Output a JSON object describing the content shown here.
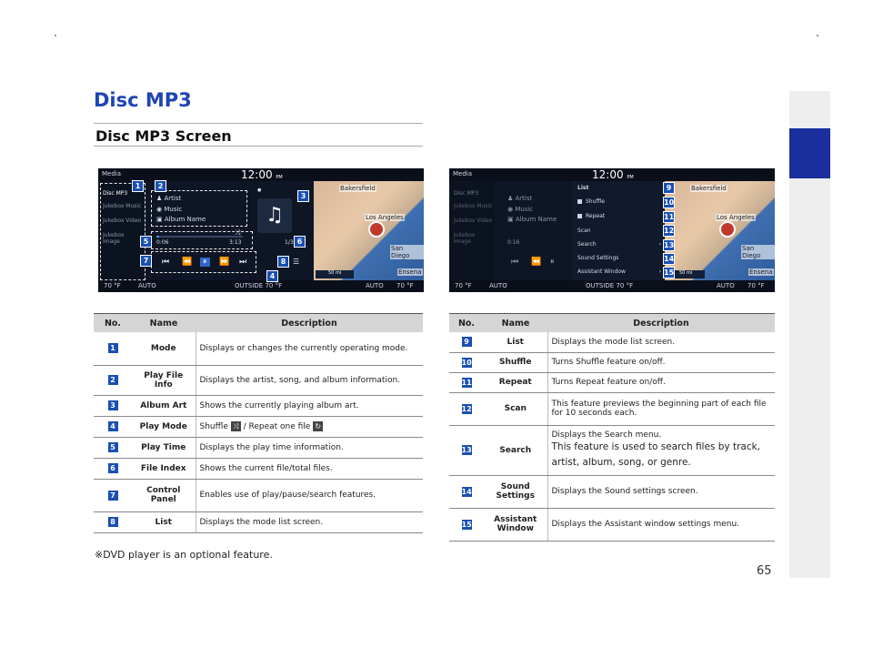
{
  "section_title": "Disc MP3",
  "subsection_title": "Disc MP3 Screen",
  "screen_left": {
    "header": "Media",
    "clock": "12:00",
    "clock_ampm": "PM",
    "modes": [
      "Disc MP3",
      "Jukebox Music",
      "Jukebox Video",
      "Jukebox Image"
    ],
    "artist": "Artist",
    "music": "Music",
    "album": "Album Name",
    "time_elapsed": "0:06",
    "time_total": "3:13",
    "file_index": "1/3",
    "progress_fraction": 0.03,
    "map_cities": [
      "Bakersfield",
      "Los Angeles",
      "San Diego",
      "Ensena"
    ],
    "map_scale": "50 mi",
    "bottom_left_temp": "70 °F",
    "bottom_left_mode": "AUTO",
    "outside": "OUTSIDE  70 °F",
    "bottom_right_mode": "AUTO",
    "bottom_right_temp": "70 °F",
    "badges": [
      "1",
      "2",
      "3",
      "4",
      "5",
      "6",
      "7",
      "8"
    ]
  },
  "screen_right": {
    "header": "Media",
    "clock": "12:00",
    "clock_ampm": "PM",
    "modes": [
      "Disc MP3",
      "Jukebox Music",
      "Jukebox Video",
      "Jukebox Image"
    ],
    "artist": "Artist",
    "music": "Music",
    "album": "Album Name",
    "time_elapsed": "0:16",
    "list_title": "List",
    "list_items": [
      "Shuffle",
      "Repeat",
      "Scan",
      "Search",
      "Sound Settings",
      "Assistant Window"
    ],
    "map_cities": [
      "Bakersfield",
      "Los Angeles",
      "San Diego",
      "Ensena"
    ],
    "map_scale": "50 mi",
    "bottom_left_temp": "70 °F",
    "bottom_left_mode": "AUTO",
    "outside": "OUTSIDE  70 °F",
    "bottom_right_mode": "AUTO",
    "bottom_right_temp": "70 °F",
    "badges": [
      "9",
      "10",
      "11",
      "12",
      "13",
      "14",
      "15"
    ]
  },
  "table_headers": {
    "no": "No.",
    "name": "Name",
    "description": "Description"
  },
  "table_left": [
    {
      "no": "1",
      "name": "Mode",
      "desc": "Displays or changes the currently operating mode."
    },
    {
      "no": "2",
      "name": "Play File Info",
      "desc": "Displays the artist, song, and album information."
    },
    {
      "no": "3",
      "name": "Album Art",
      "desc": "Shows the currently playing album art."
    },
    {
      "no": "4",
      "name": "Play Mode",
      "desc_a": "Shuffle",
      "desc_b": " / Repeat one file "
    },
    {
      "no": "5",
      "name": "Play Time",
      "desc": "Displays the play time information."
    },
    {
      "no": "6",
      "name": "File Index",
      "desc": "Shows the current file/total files."
    },
    {
      "no": "7",
      "name": "Control Panel",
      "desc": "Enables use of play/pause/search features."
    },
    {
      "no": "8",
      "name": "List",
      "desc": "Displays the mode list screen."
    }
  ],
  "table_right": [
    {
      "no": "9",
      "name": "List",
      "desc": "Displays the mode list screen."
    },
    {
      "no": "10",
      "name": "Shuffle",
      "desc": "Turns Shuffle feature on/off."
    },
    {
      "no": "11",
      "name": "Repeat",
      "desc": "Turns Repeat feature on/off."
    },
    {
      "no": "12",
      "name": "Scan",
      "desc": "This feature previews the beginning part of each file for 10 seconds each."
    },
    {
      "no": "13",
      "name": "Search",
      "desc": "Displays the Search menu.",
      "desc2": "This feature is used to search files by track, artist, album, song, or genre."
    },
    {
      "no": "14",
      "name": "Sound Settings",
      "desc": "Displays the Sound settings screen."
    },
    {
      "no": "15",
      "name": "Assistant Window",
      "desc": "Displays the Assistant window settings menu."
    }
  ],
  "note": "※DVD player is an optional feature.",
  "page_number": "65"
}
